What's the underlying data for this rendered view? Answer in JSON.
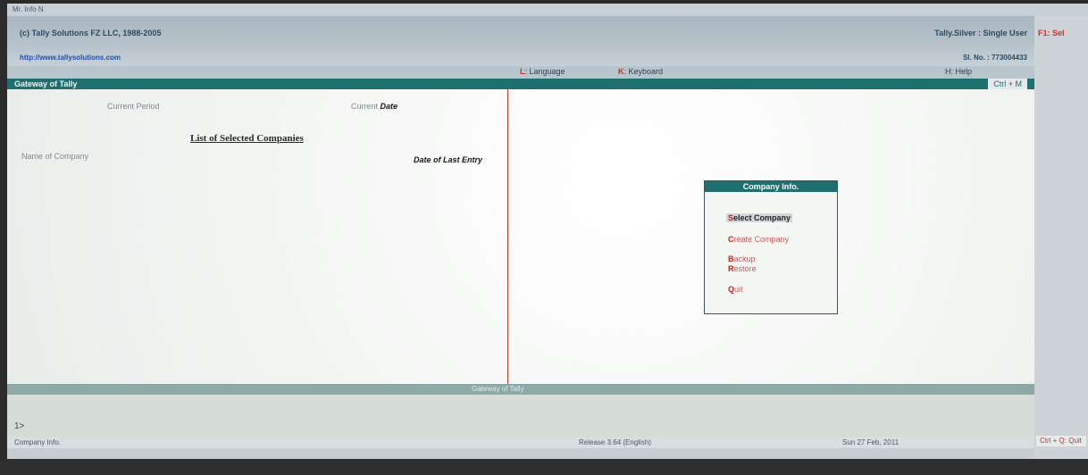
{
  "window": {
    "title": "Mr. Info N"
  },
  "header": {
    "copyright": "(c) Tally Solutions FZ LLC, 1988-2005",
    "website": "http://www.tallysolutions.com",
    "edition": "Tally.Silver : Single User",
    "serial": "Sl. No. : 773004433"
  },
  "menu": {
    "language_key": "L",
    "language_label": ": Language",
    "keyboard_key": "K",
    "keyboard_label": ": Keyboard",
    "help_label": "H: Help"
  },
  "panel": {
    "title": "Gateway of Tally",
    "shortcut": "Ctrl + M"
  },
  "left_panel": {
    "current_period_label": "Current Period",
    "current_date_label": "Current",
    "current_date_bold": "Date",
    "list_heading": "List of Selected Companies",
    "name_of_company_label": "Name of Company",
    "date_of_last_entry_label": "Date of Last Entry"
  },
  "company_menu": {
    "title": "Company Info.",
    "options": [
      {
        "key": "S",
        "rest": "elect Company",
        "selected": true
      },
      {
        "key": "C",
        "rest": "reate Company",
        "selected": false
      },
      {
        "key": "B",
        "rest": "ackup",
        "selected": false
      },
      {
        "key": "R",
        "rest": "estore",
        "selected": false
      },
      {
        "key": "Q",
        "rest": "uit",
        "selected": false
      }
    ]
  },
  "gateway_bar": {
    "text": "Gateway of Tally"
  },
  "calculator": {
    "prompt": "1>"
  },
  "status": {
    "left": "Company Info.",
    "release": "Release 3.64 (English)",
    "date": "Sun 27 Feb, 2011"
  },
  "right_panel": {
    "top_key": "F1: Sel",
    "bottom_button": "Ctrl + Q: Quit"
  },
  "colors": {
    "panel_teal": "#1f6f6e",
    "hotkey_red": "#c42020",
    "divider_red": "#c0392b"
  }
}
